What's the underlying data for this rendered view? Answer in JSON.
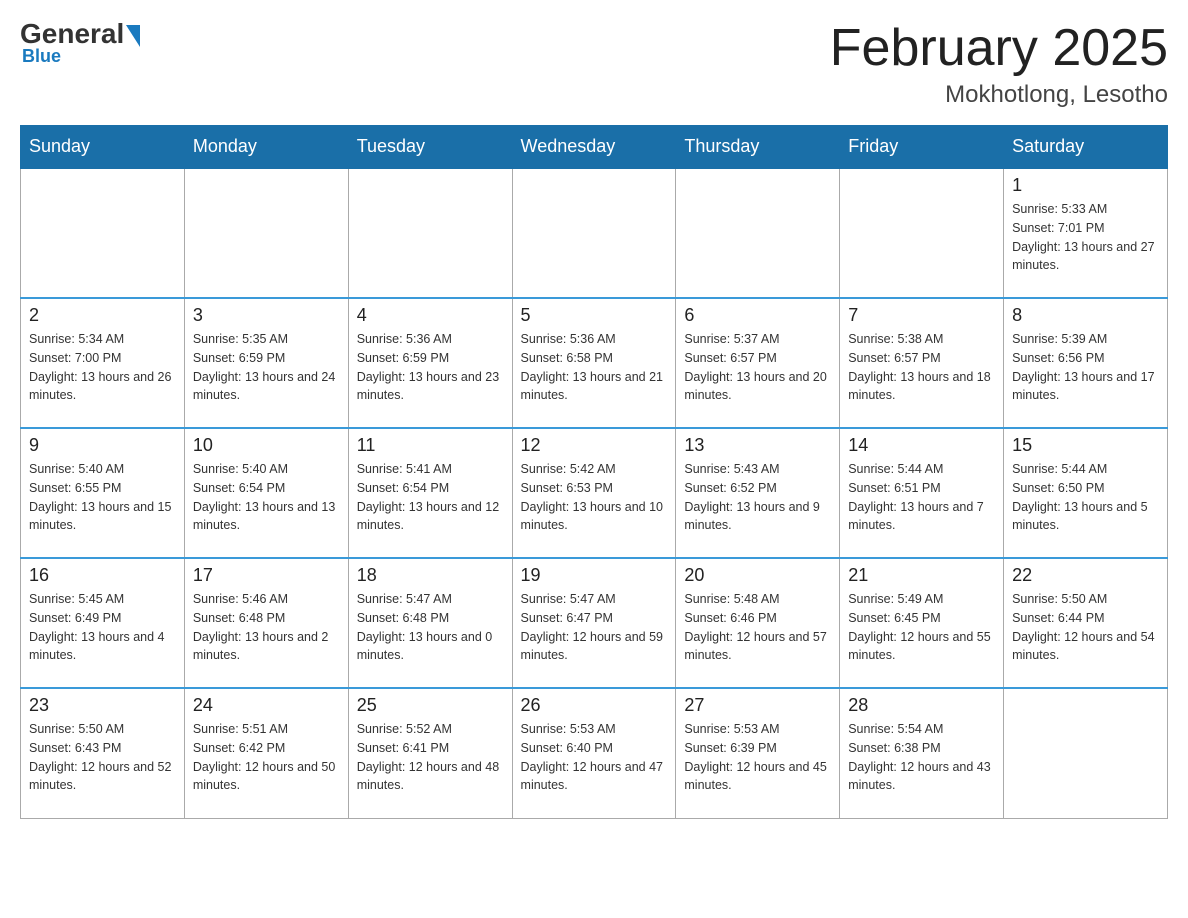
{
  "header": {
    "logo_general": "General",
    "logo_blue": "Blue",
    "month_title": "February 2025",
    "location": "Mokhotlong, Lesotho"
  },
  "days_of_week": [
    "Sunday",
    "Monday",
    "Tuesday",
    "Wednesday",
    "Thursday",
    "Friday",
    "Saturday"
  ],
  "weeks": [
    [
      {
        "day": "",
        "info": ""
      },
      {
        "day": "",
        "info": ""
      },
      {
        "day": "",
        "info": ""
      },
      {
        "day": "",
        "info": ""
      },
      {
        "day": "",
        "info": ""
      },
      {
        "day": "",
        "info": ""
      },
      {
        "day": "1",
        "info": "Sunrise: 5:33 AM\nSunset: 7:01 PM\nDaylight: 13 hours and 27 minutes."
      }
    ],
    [
      {
        "day": "2",
        "info": "Sunrise: 5:34 AM\nSunset: 7:00 PM\nDaylight: 13 hours and 26 minutes."
      },
      {
        "day": "3",
        "info": "Sunrise: 5:35 AM\nSunset: 6:59 PM\nDaylight: 13 hours and 24 minutes."
      },
      {
        "day": "4",
        "info": "Sunrise: 5:36 AM\nSunset: 6:59 PM\nDaylight: 13 hours and 23 minutes."
      },
      {
        "day": "5",
        "info": "Sunrise: 5:36 AM\nSunset: 6:58 PM\nDaylight: 13 hours and 21 minutes."
      },
      {
        "day": "6",
        "info": "Sunrise: 5:37 AM\nSunset: 6:57 PM\nDaylight: 13 hours and 20 minutes."
      },
      {
        "day": "7",
        "info": "Sunrise: 5:38 AM\nSunset: 6:57 PM\nDaylight: 13 hours and 18 minutes."
      },
      {
        "day": "8",
        "info": "Sunrise: 5:39 AM\nSunset: 6:56 PM\nDaylight: 13 hours and 17 minutes."
      }
    ],
    [
      {
        "day": "9",
        "info": "Sunrise: 5:40 AM\nSunset: 6:55 PM\nDaylight: 13 hours and 15 minutes."
      },
      {
        "day": "10",
        "info": "Sunrise: 5:40 AM\nSunset: 6:54 PM\nDaylight: 13 hours and 13 minutes."
      },
      {
        "day": "11",
        "info": "Sunrise: 5:41 AM\nSunset: 6:54 PM\nDaylight: 13 hours and 12 minutes."
      },
      {
        "day": "12",
        "info": "Sunrise: 5:42 AM\nSunset: 6:53 PM\nDaylight: 13 hours and 10 minutes."
      },
      {
        "day": "13",
        "info": "Sunrise: 5:43 AM\nSunset: 6:52 PM\nDaylight: 13 hours and 9 minutes."
      },
      {
        "day": "14",
        "info": "Sunrise: 5:44 AM\nSunset: 6:51 PM\nDaylight: 13 hours and 7 minutes."
      },
      {
        "day": "15",
        "info": "Sunrise: 5:44 AM\nSunset: 6:50 PM\nDaylight: 13 hours and 5 minutes."
      }
    ],
    [
      {
        "day": "16",
        "info": "Sunrise: 5:45 AM\nSunset: 6:49 PM\nDaylight: 13 hours and 4 minutes."
      },
      {
        "day": "17",
        "info": "Sunrise: 5:46 AM\nSunset: 6:48 PM\nDaylight: 13 hours and 2 minutes."
      },
      {
        "day": "18",
        "info": "Sunrise: 5:47 AM\nSunset: 6:48 PM\nDaylight: 13 hours and 0 minutes."
      },
      {
        "day": "19",
        "info": "Sunrise: 5:47 AM\nSunset: 6:47 PM\nDaylight: 12 hours and 59 minutes."
      },
      {
        "day": "20",
        "info": "Sunrise: 5:48 AM\nSunset: 6:46 PM\nDaylight: 12 hours and 57 minutes."
      },
      {
        "day": "21",
        "info": "Sunrise: 5:49 AM\nSunset: 6:45 PM\nDaylight: 12 hours and 55 minutes."
      },
      {
        "day": "22",
        "info": "Sunrise: 5:50 AM\nSunset: 6:44 PM\nDaylight: 12 hours and 54 minutes."
      }
    ],
    [
      {
        "day": "23",
        "info": "Sunrise: 5:50 AM\nSunset: 6:43 PM\nDaylight: 12 hours and 52 minutes."
      },
      {
        "day": "24",
        "info": "Sunrise: 5:51 AM\nSunset: 6:42 PM\nDaylight: 12 hours and 50 minutes."
      },
      {
        "day": "25",
        "info": "Sunrise: 5:52 AM\nSunset: 6:41 PM\nDaylight: 12 hours and 48 minutes."
      },
      {
        "day": "26",
        "info": "Sunrise: 5:53 AM\nSunset: 6:40 PM\nDaylight: 12 hours and 47 minutes."
      },
      {
        "day": "27",
        "info": "Sunrise: 5:53 AM\nSunset: 6:39 PM\nDaylight: 12 hours and 45 minutes."
      },
      {
        "day": "28",
        "info": "Sunrise: 5:54 AM\nSunset: 6:38 PM\nDaylight: 12 hours and 43 minutes."
      },
      {
        "day": "",
        "info": ""
      }
    ]
  ]
}
